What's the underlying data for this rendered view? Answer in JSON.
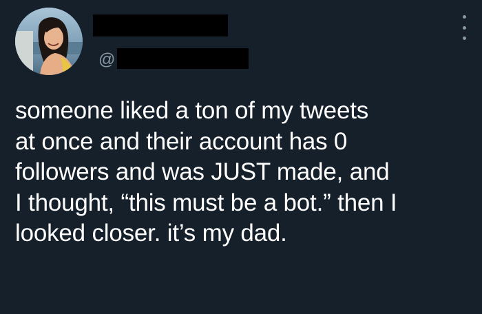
{
  "tweet": {
    "handle_prefix": "@",
    "more_icon": "more-vertical-icon",
    "lines": [
      "someone liked a ton of my tweets",
      "at once and their account has 0",
      "followers and was JUST made, and",
      "I thought, “this must be a bot.” then I",
      "looked closer. it’s my dad."
    ]
  },
  "colors": {
    "background": "#15202b",
    "text": "#ffffff",
    "secondary": "#8899a6",
    "redaction": "#000000"
  }
}
